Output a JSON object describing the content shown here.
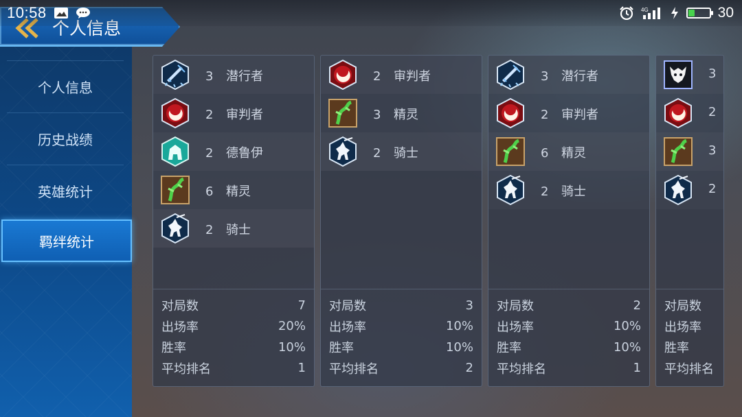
{
  "status_bar": {
    "time": "10:58",
    "battery": "30",
    "battery_level_percent": 30,
    "network": "4G",
    "left_icons": [
      "image-notification-icon",
      "chat-bubble-icon"
    ],
    "right_icons": [
      "alarm-icon",
      "signal-icon",
      "charging-icon",
      "battery-icon"
    ]
  },
  "header": {
    "title": "个人信息",
    "back_icon": "back-chevron-icon"
  },
  "sidebar": {
    "items": [
      {
        "label": "个人信息",
        "active": false
      },
      {
        "label": "历史战绩",
        "active": false
      },
      {
        "label": "英雄统计",
        "active": false
      },
      {
        "label": "羁绊统计",
        "active": true
      }
    ]
  },
  "colors": {
    "sidebar_active": "#1a79d3",
    "header_blue": "#1d6fc2",
    "accent_gold": "#e6b44a",
    "battery_green": "#47d34d"
  },
  "stat_labels": {
    "games": "对局数",
    "appearance": "出场率",
    "win_rate": "胜率",
    "avg_rank": "平均排名"
  },
  "cards": [
    {
      "traits": [
        {
          "icon": "assassin-sword-icon",
          "count": "3",
          "name": "潜行者"
        },
        {
          "icon": "judge-crescent-icon",
          "count": "2",
          "name": "审判者"
        },
        {
          "icon": "druid-ent-icon",
          "count": "2",
          "name": "德鲁伊"
        },
        {
          "icon": "elf-vine-icon",
          "count": "6",
          "name": "精灵"
        },
        {
          "icon": "knight-horse-icon",
          "count": "2",
          "name": "骑士"
        }
      ],
      "stats": {
        "games": "7",
        "appearance": "20%",
        "win_rate": "10%",
        "avg_rank": "1"
      }
    },
    {
      "traits": [
        {
          "icon": "judge-crescent-icon",
          "count": "2",
          "name": "审判者"
        },
        {
          "icon": "elf-vine-icon",
          "count": "3",
          "name": "精灵"
        },
        {
          "icon": "knight-horse-icon",
          "count": "2",
          "name": "骑士"
        }
      ],
      "stats": {
        "games": "3",
        "appearance": "10%",
        "win_rate": "10%",
        "avg_rank": "2"
      }
    },
    {
      "traits": [
        {
          "icon": "assassin-sword-icon",
          "count": "3",
          "name": "潜行者"
        },
        {
          "icon": "judge-crescent-icon",
          "count": "2",
          "name": "审判者"
        },
        {
          "icon": "elf-vine-icon",
          "count": "6",
          "name": "精灵"
        },
        {
          "icon": "knight-horse-icon",
          "count": "2",
          "name": "骑士"
        }
      ],
      "stats": {
        "games": "2",
        "appearance": "10%",
        "win_rate": "10%",
        "avg_rank": "1"
      }
    },
    {
      "traits": [
        {
          "icon": "demon-skull-icon",
          "count": "3",
          "name": ""
        },
        {
          "icon": "judge-crescent-icon",
          "count": "2",
          "name": ""
        },
        {
          "icon": "elf-vine-icon",
          "count": "3",
          "name": ""
        },
        {
          "icon": "knight-horse-icon",
          "count": "2",
          "name": ""
        }
      ],
      "stats": {
        "games": "",
        "appearance": "",
        "win_rate": "",
        "avg_rank": ""
      }
    }
  ]
}
